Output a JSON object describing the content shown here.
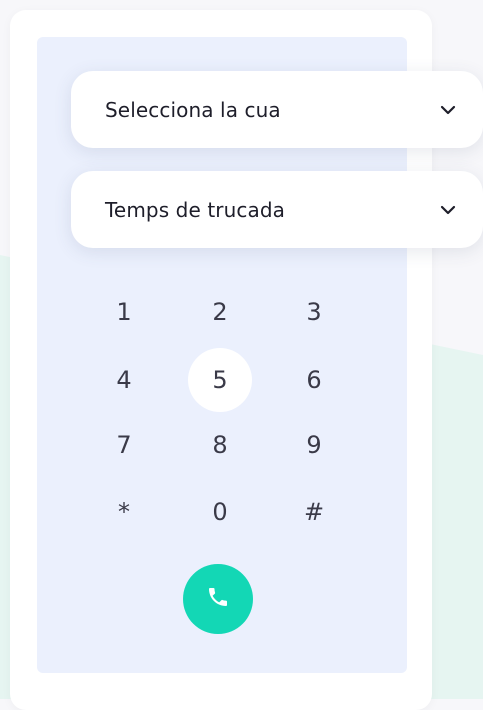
{
  "dropdowns": {
    "queue": {
      "label": "Selecciona la cua",
      "icon": "chevron-down-icon"
    },
    "call_time": {
      "label": "Temps de trucada",
      "icon": "chevron-down-icon"
    }
  },
  "keypad": {
    "keys": [
      "1",
      "2",
      "3",
      "4",
      "5",
      "6",
      "7",
      "8",
      "9",
      "*",
      "0",
      "#"
    ],
    "active_key": "5"
  },
  "call_button": {
    "icon": "phone-icon"
  },
  "colors": {
    "panel": "#ebf0fd",
    "call_button": "#13d7b5",
    "background_accent": "#e6f5f1"
  }
}
